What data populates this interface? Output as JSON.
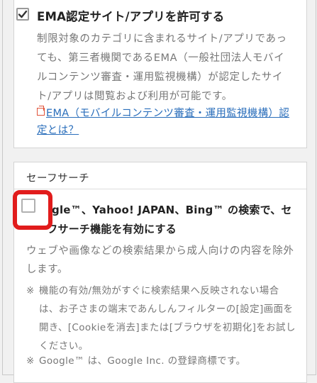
{
  "ema": {
    "checked": true,
    "label": "EMA認定サイト/アプリを許可する",
    "description": "制限対象のカテゴリに含まれるサイト/アプリであっても、第三者機関であるEMA（一般社団法人モバイルコンテンツ審査・運用監視機構）が認定したサイト/アプリは閲覧および利用が可能です。",
    "link_text": "EMA（モバイルコンテンツ審査・運用監視機構）認定とは？"
  },
  "safe_search": {
    "title": "セーフサーチ",
    "checked": false,
    "label": "Google™、Yahoo! JAPAN、Bing™ の検索で、セーフサーチ機能を有効にする",
    "label_visible": "oogle™、Yahoo! JAPAN、Bing™ の検索で、セーフサーチ機能を有効にする",
    "description": "ウェブや画像などの検索結果から成人向けの内容を除外します。",
    "notes": [
      {
        "mark": "※",
        "text": "機能の有効/無効がすぐに検索結果へ反映されない場合は、お子さまの端末であんしんフィルターの[設定]画面を開き、[Cookieを消去]または[ブラウザを初期化]をお試しください。"
      },
      {
        "mark": "※",
        "text": "Google™ は、Google Inc. の登録商標です。"
      }
    ]
  },
  "colors": {
    "highlight": "#e11c1c",
    "link": "#2a6ebb",
    "link_icon": "#e0533a",
    "muted_text": "#777777"
  }
}
